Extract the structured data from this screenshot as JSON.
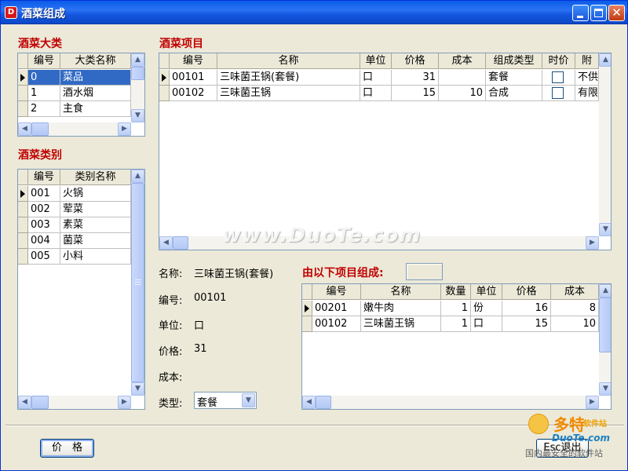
{
  "window": {
    "title": "酒菜组成",
    "app_icon": "D",
    "controls": [
      "minimize-icon",
      "maximize-icon",
      "close-icon"
    ],
    "close_glyph": "✕"
  },
  "category_panel": {
    "label": "酒菜大类",
    "headers": [
      "编号",
      "大类名称"
    ],
    "rows": [
      {
        "code": "0",
        "name": "菜品",
        "selected": true
      },
      {
        "code": "1",
        "name": "酒水烟",
        "selected": false
      },
      {
        "code": "2",
        "name": "主食",
        "selected": false
      }
    ]
  },
  "type_panel": {
    "label": "酒菜类别",
    "headers": [
      "编号",
      "类别名称"
    ],
    "rows": [
      {
        "code": "001",
        "name": "火锅"
      },
      {
        "code": "002",
        "name": "荤菜"
      },
      {
        "code": "003",
        "name": "素菜"
      },
      {
        "code": "004",
        "name": "菌菜"
      },
      {
        "code": "005",
        "name": "小料"
      }
    ]
  },
  "items_panel": {
    "label": "酒菜项目",
    "headers": [
      "编号",
      "名称",
      "单位",
      "价格",
      "成本",
      "组成类型",
      "时价",
      "附"
    ],
    "rows": [
      {
        "code": "00101",
        "name": "三味菌王锅(套餐)",
        "unit": "口",
        "price": "31",
        "cost": "",
        "comp_type": "套餐",
        "market_price": false,
        "extra": "不供"
      },
      {
        "code": "00102",
        "name": "三味菌王锅",
        "unit": "口",
        "price": "15",
        "cost": "10",
        "comp_type": "合成",
        "market_price": false,
        "extra": "有限"
      }
    ]
  },
  "detail": {
    "name_label": "名称:",
    "name_value": "三味菌王锅(套餐)",
    "code_label": "编号:",
    "code_value": "00101",
    "unit_label": "单位:",
    "unit_value": "口",
    "price_label": "价格:",
    "price_value": "31",
    "cost_label": "成本:",
    "cost_value": "",
    "type_label": "类型:",
    "type_value": "套餐"
  },
  "composition_panel": {
    "label": "由以下项目组成:",
    "headers": [
      "编号",
      "名称",
      "数量",
      "单位",
      "价格",
      "成本"
    ],
    "rows": [
      {
        "code": "00201",
        "name": "嫩牛肉",
        "qty": "1",
        "unit": "份",
        "price": "16",
        "cost": "8"
      },
      {
        "code": "00102",
        "name": "三味菌王锅",
        "qty": "1",
        "unit": "口",
        "price": "15",
        "cost": "10"
      }
    ]
  },
  "buttons": {
    "price": "价　格",
    "exit": "Esc退出"
  },
  "watermark": "www.DuoTe.com",
  "brand": {
    "logo": "多特",
    "tagline": "软件站",
    "url": "DuoTe.com",
    "cn": "国内最安全的软件站"
  },
  "colors": {
    "title_bar": "#0a5ce8",
    "section_label": "#c00000",
    "selection": "#316ac5",
    "window_bg": "#ece9d8"
  }
}
